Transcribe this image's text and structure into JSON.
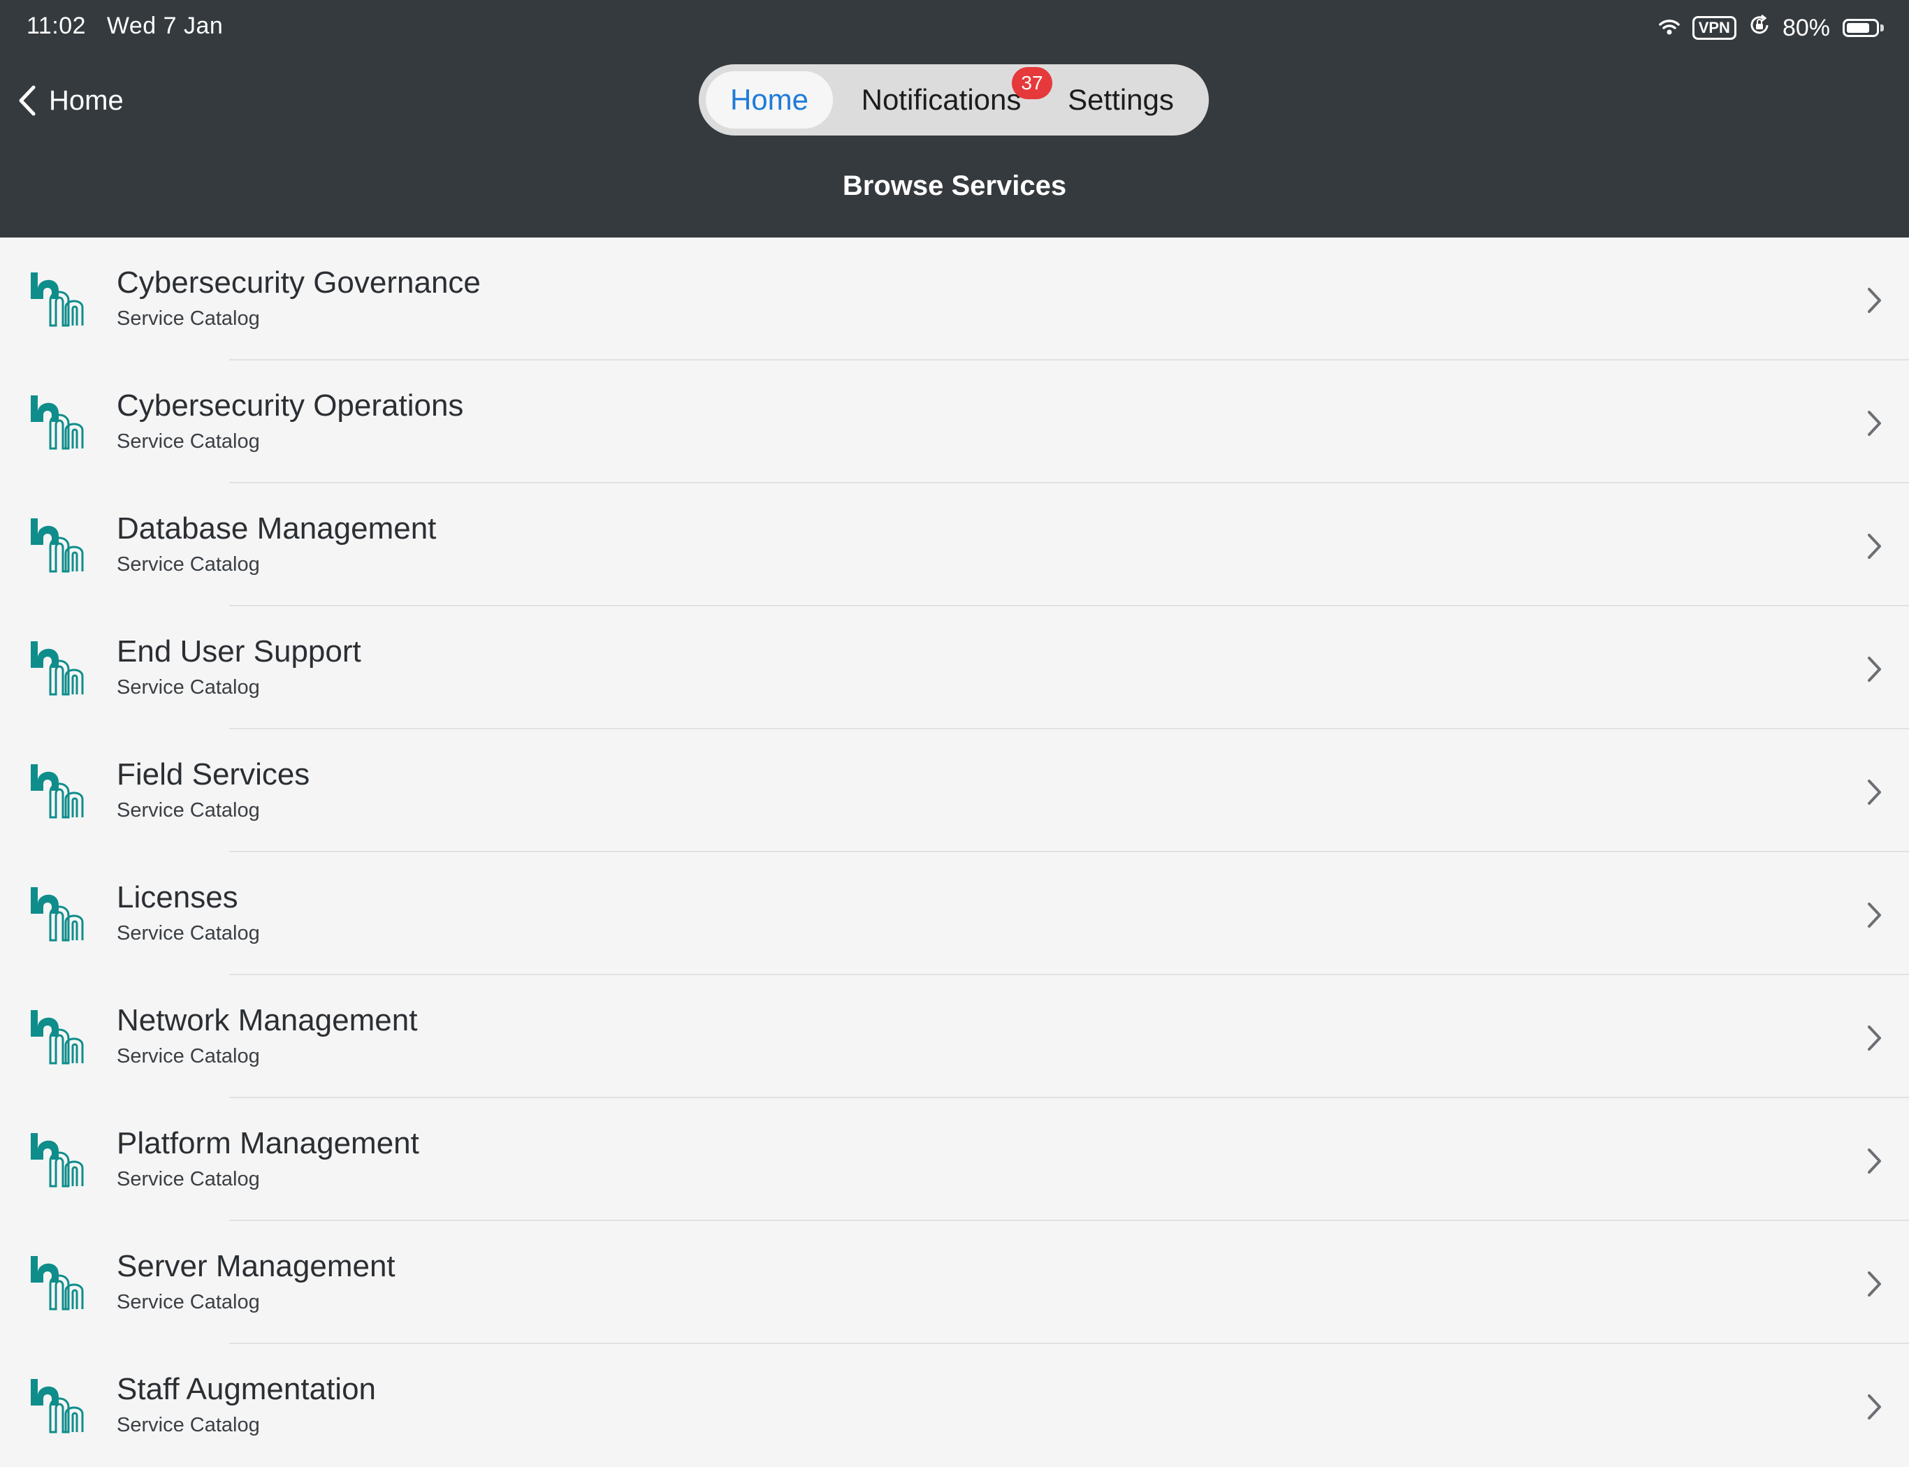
{
  "status_bar": {
    "time": "11:02",
    "date": "Wed 7 Jan",
    "vpn": "VPN",
    "battery_percent": "80%",
    "battery_level": 0.8
  },
  "nav": {
    "back_label": "Home",
    "tabs": [
      {
        "label": "Home",
        "active": true
      },
      {
        "label": "Notifications",
        "badge": "37"
      },
      {
        "label": "Settings"
      }
    ],
    "title": "Browse Services"
  },
  "colors": {
    "header_bg": "#353a3e",
    "accent": "#1f7bd8",
    "badge": "#e6393b",
    "icon_teal": "#0e8d8b",
    "list_bg": "#f5f5f5"
  },
  "icon_names": [
    "app-logo-icon",
    "chevron-right-icon",
    "chevron-left-icon",
    "wifi-icon",
    "orientation-lock-icon",
    "battery-icon"
  ],
  "services": [
    {
      "title": "Cybersecurity Governance",
      "subtitle": "Service Catalog"
    },
    {
      "title": "Cybersecurity Operations",
      "subtitle": "Service Catalog"
    },
    {
      "title": "Database Management",
      "subtitle": "Service Catalog"
    },
    {
      "title": "End User Support",
      "subtitle": "Service Catalog"
    },
    {
      "title": "Field Services",
      "subtitle": "Service Catalog"
    },
    {
      "title": "Licenses",
      "subtitle": "Service Catalog"
    },
    {
      "title": "Network Management",
      "subtitle": "Service Catalog"
    },
    {
      "title": "Platform Management",
      "subtitle": "Service Catalog"
    },
    {
      "title": "Server Management",
      "subtitle": "Service Catalog"
    },
    {
      "title": "Staff Augmentation",
      "subtitle": "Service Catalog"
    }
  ]
}
